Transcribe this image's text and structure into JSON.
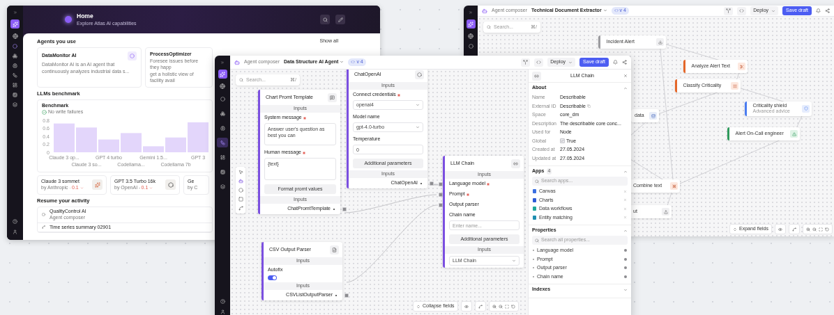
{
  "home_window": {
    "header": {
      "title": "Home",
      "subtitle": "Explore Atlas AI capabilities"
    },
    "agents": {
      "title": "Agents you use",
      "link": "Show all",
      "cards": [
        {
          "name": "DataMonitor AI",
          "lines": [
            "DataMonitor AI is an AI agent that",
            "continuously analyzes industrial data s..."
          ]
        },
        {
          "name": "ProcessOptimizer",
          "lines": [
            "Foresee issues before they happ",
            "get a holistic view of facility avail"
          ]
        }
      ]
    },
    "benchmark": {
      "title": "LLMs benchmark",
      "card_title": "Benchmark",
      "status": "No write failures",
      "chart_data": {
        "type": "bar",
        "categories": [
          "Claude 3 op...",
          "Claude 3 so...",
          "GPT 4 turbo",
          "Codellama...",
          "Gemini 1.5...",
          "Codellama 7b",
          "GPT 3"
        ],
        "values": [
          0.72,
          0.62,
          0.32,
          0.48,
          0.15,
          0.37,
          0.75
        ],
        "ylim": [
          0,
          0.8
        ],
        "yticks": [
          0,
          0.2,
          0.4,
          0.6,
          0.8
        ]
      }
    },
    "models": [
      {
        "name": "Claude 3 sommet",
        "vendor": "by Anthropic",
        "score": "0.1"
      },
      {
        "name": "GPT 3.5 Turbo 16k",
        "vendor": "by OpenAI",
        "score": "0.1"
      },
      {
        "name": "Ge",
        "vendor": "by C"
      }
    ],
    "activity": {
      "title": "Resume your activity",
      "items": [
        {
          "title": "QualityControl AI",
          "subtitle": "Agent composer"
        },
        {
          "title": "Time series summary 02901"
        }
      ]
    }
  },
  "extractor_window": {
    "breadcrumb": "Agent composer",
    "title": "Technical Document Extractor",
    "version": "v 4",
    "deploy": "Deploy",
    "save": "Save draft",
    "search": {
      "placeholder": "Search...",
      "shortcut": "⌘/"
    },
    "nodes": [
      {
        "label": "Incident Alert",
        "color": "#9a9a9e",
        "kind": "download"
      },
      {
        "label": "Analyze Alert Text",
        "color": "#e4672a",
        "kind": "scissors"
      },
      {
        "label": "Classify Criticality",
        "color": "#e4672a",
        "kind": "list"
      },
      {
        "label": "Criticality shield",
        "sublabel": "Advanced advice",
        "color": "#4a7cf0",
        "kind": "shield"
      },
      {
        "label": "Alert On-Call engineer",
        "color": "#2f9a5c",
        "kind": "alert"
      },
      {
        "label": "data",
        "kind": "database"
      },
      {
        "label": "Combine text",
        "kind": "shrink"
      },
      {
        "label": "ut",
        "kind": "upload"
      }
    ],
    "footer": {
      "expand": "Expand fields"
    }
  },
  "composer_window": {
    "breadcrumb": "Agent composer",
    "title": "Data Structure AI Agent",
    "version": "v 4",
    "deploy": "Deploy",
    "save": "Save draft",
    "sidebar": [
      {
        "selected": false
      },
      {
        "selected": false
      },
      {
        "selected": false
      },
      {
        "selected": true
      },
      {
        "selected": false
      },
      {
        "selected": false
      },
      {
        "selected": false
      }
    ],
    "search": {
      "placeholder": "Search...",
      "shortcut": "⌘/"
    },
    "nodes": [
      {
        "title": "Chart Promt Template",
        "kind": "chat",
        "rows": [
          {
            "kind": "section",
            "text": "Inputs"
          },
          {
            "kind": "textarea",
            "label": "System message",
            "required": true,
            "value": "Answer user's question as best you can"
          },
          {
            "kind": "textarea",
            "label": "Human message",
            "required": true,
            "value": "{text}"
          },
          {
            "kind": "button",
            "text": "Format promt values"
          },
          {
            "kind": "section",
            "text": "Inputs"
          },
          {
            "kind": "output",
            "text": "ChatPromtTemplate"
          }
        ]
      },
      {
        "title": "ChatOpenAI",
        "kind": "openai",
        "rows": [
          {
            "kind": "section",
            "text": "Inputs"
          },
          {
            "kind": "select",
            "label": "Connect credentials",
            "required": true,
            "value": "openai4"
          },
          {
            "kind": "select",
            "label": "Model name",
            "required": false,
            "value": "gpt-4.0-turbo"
          },
          {
            "kind": "input",
            "label": "Temperature",
            "required": false,
            "value": "0"
          },
          {
            "kind": "button",
            "text": "Additional parameters"
          },
          {
            "kind": "section",
            "text": "Inputs"
          },
          {
            "kind": "output",
            "text": "ChatOpenAI"
          }
        ]
      },
      {
        "title": "LLM Chain",
        "kind": "llm",
        "rows": [
          {
            "kind": "section",
            "text": "Inputs"
          },
          {
            "kind": "port",
            "label": "Language model",
            "required": true
          },
          {
            "kind": "port",
            "label": "Prompt",
            "required": true
          },
          {
            "kind": "port",
            "label": "Output parser",
            "required": false
          },
          {
            "kind": "input",
            "label": "Chain name",
            "required": false,
            "placeholder": "Enter name..."
          },
          {
            "kind": "button",
            "text": "Additional parameters"
          },
          {
            "kind": "section",
            "text": "Inputs"
          },
          {
            "kind": "select",
            "value": "LLM Chain"
          }
        ]
      },
      {
        "title": "CSV Output Parser",
        "kind": "csv",
        "rows": [
          {
            "kind": "section",
            "text": "Inputs"
          },
          {
            "kind": "toggle",
            "label": "Autofix",
            "on": true
          },
          {
            "kind": "section",
            "text": "Inputs"
          },
          {
            "kind": "output",
            "text": "CSVListOutputParser"
          }
        ]
      }
    ],
    "footer": {
      "collapse": "Collapse fields"
    },
    "panel": {
      "title": "LLM Chain",
      "about": {
        "title": "About",
        "expanded": true,
        "rows": [
          {
            "label": "Name",
            "value": "Describable"
          },
          {
            "label": "External ID",
            "value": "Describable",
            "copy": true
          },
          {
            "label": "Space",
            "value": "core_dm"
          },
          {
            "label": "Description",
            "value": "The describable core conc..."
          },
          {
            "label": "Used for",
            "value": "Node"
          },
          {
            "label": "Global",
            "value": "True",
            "checked": true
          },
          {
            "label": "Created at",
            "value": "27.05.2024"
          },
          {
            "label": "Updated at",
            "value": "27.05.2024"
          }
        ]
      },
      "apps": {
        "title": "Apps",
        "count": "4",
        "expanded": true,
        "placeholder": "Search apps...",
        "items": [
          {
            "label": "Canvas",
            "color": "#3b6fe0"
          },
          {
            "label": "Charts",
            "color": "#2d5bd6"
          },
          {
            "label": "Data workflows",
            "color": "#20a89a"
          },
          {
            "label": "Entity matching",
            "color": "#1f8fb0"
          }
        ]
      },
      "properties": {
        "title": "Properties",
        "expanded": true,
        "placeholder": "Search all properties...",
        "items": [
          "Language model",
          "Prompt",
          "Output parser",
          "Chain name"
        ]
      },
      "indexes": {
        "title": "Indexes",
        "expanded": false
      }
    }
  }
}
